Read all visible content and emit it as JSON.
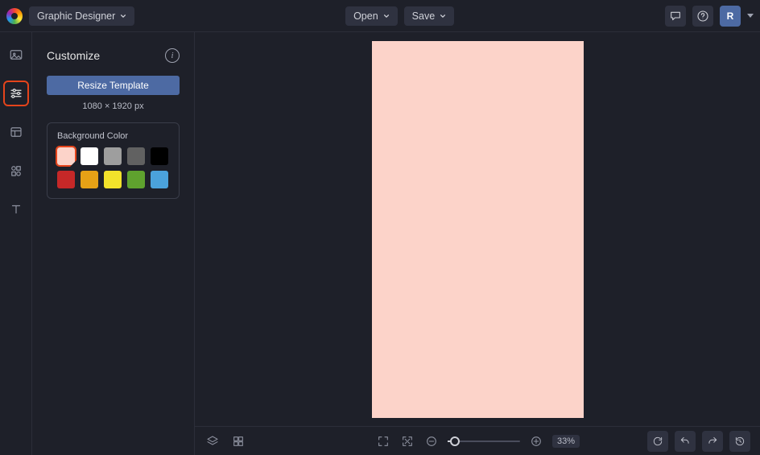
{
  "header": {
    "appName": "Graphic Designer",
    "open": "Open",
    "save": "Save",
    "avatarInitial": "R"
  },
  "panel": {
    "title": "Customize",
    "resize": "Resize Template",
    "dimensions": "1080 × 1920 px",
    "bgLabel": "Background Color"
  },
  "swatches": [
    {
      "color": "#fcd3c9",
      "selected": true
    },
    {
      "color": "#ffffff",
      "selected": false
    },
    {
      "color": "#9e9e9e",
      "selected": false
    },
    {
      "color": "#616161",
      "selected": false
    },
    {
      "color": "#000000",
      "selected": false
    },
    {
      "color": "#c62828",
      "selected": false
    },
    {
      "color": "#e6a116",
      "selected": false
    },
    {
      "color": "#f2e22b",
      "selected": false
    },
    {
      "color": "#5fa22e",
      "selected": false
    },
    {
      "color": "#4ba2db",
      "selected": false
    }
  ],
  "canvas": {
    "bg": "#fcd3c9"
  },
  "zoom": {
    "percent": "33%",
    "value": 33
  }
}
